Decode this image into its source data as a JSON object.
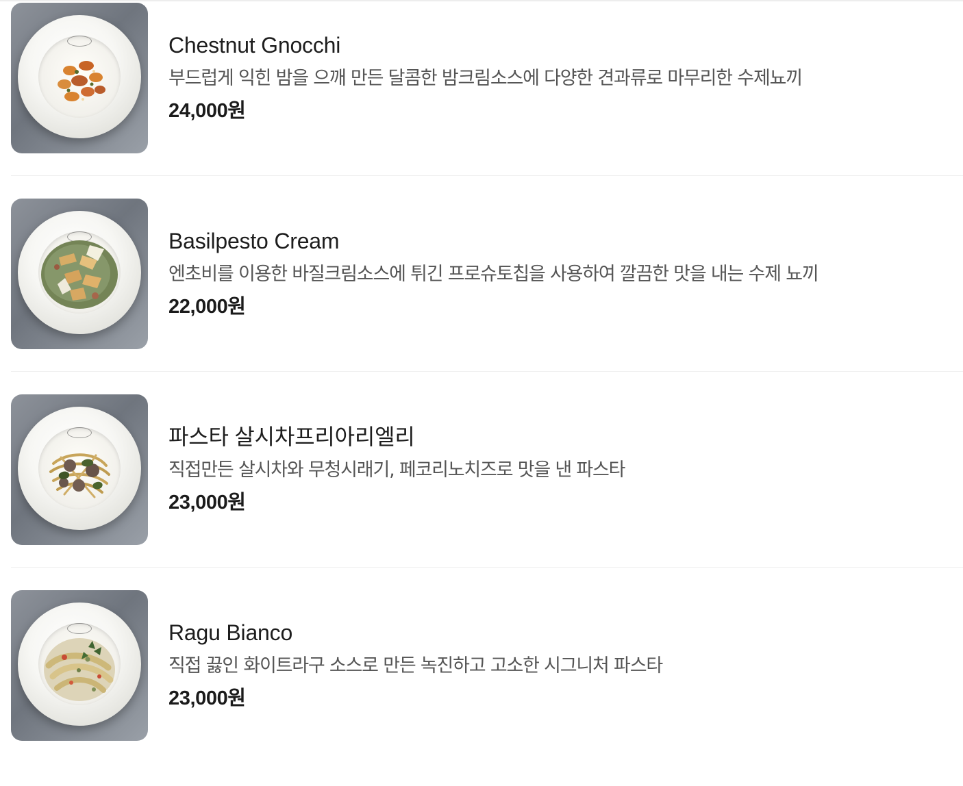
{
  "menu_items": [
    {
      "name": "Chestnut Gnocchi",
      "description": "부드럽게 익힌 밤을 으깨 만든 달콤한 밤크림소스에 다양한 견과류로 마무리한 수제뇨끼",
      "price": "24,000원"
    },
    {
      "name": "Basilpesto Cream",
      "description": "엔초비를 이용한 바질크림소스에 튀긴 프로슈토칩을 사용하여 깔끔한 맛을 내는 수제 뇨끼",
      "price": "22,000원"
    },
    {
      "name": "파스타 살시차프리아리엘리",
      "description": "직접만든 살시차와 무청시래기, 페코리노치즈로 맛을 낸 파스타",
      "price": "23,000원"
    },
    {
      "name": "Ragu Bianco",
      "description": "직접 끓인 화이트라구 소스로 만든 녹진하고 고소한 시그니처 파스타",
      "price": "23,000원"
    }
  ],
  "colors": {
    "background": "#ffffff",
    "divider": "#efefef",
    "name_text": "#1d1d1d",
    "description_text": "#555555",
    "price_text": "#1b1b1b"
  }
}
